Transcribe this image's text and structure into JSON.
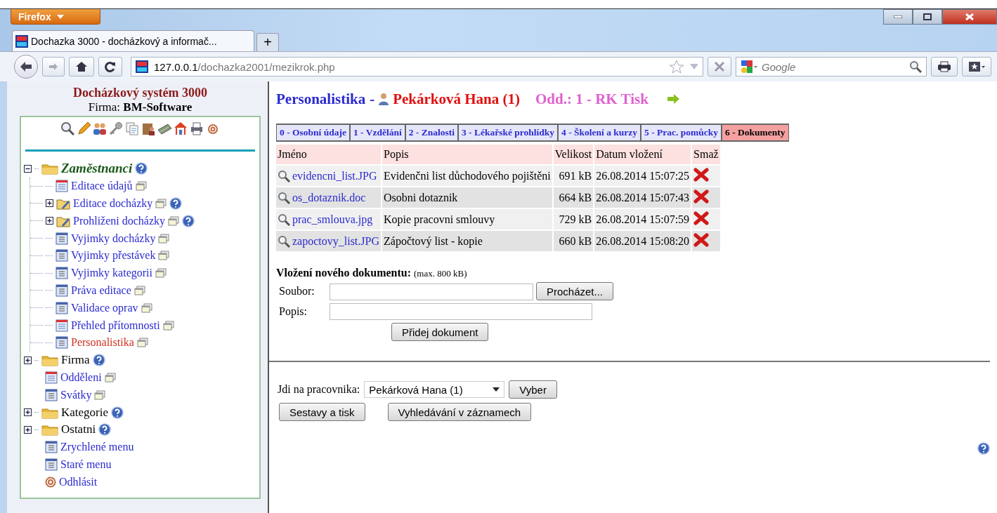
{
  "browser": {
    "menu_button": "Firefox",
    "tab": {
      "title": "Dochazka 3000 - docházkový a informač..."
    },
    "new_tab": "+",
    "url": {
      "host": "127.0.0.1",
      "path": "/dochazka2001/mezikrok.php"
    },
    "search": {
      "placeholder": "Google"
    }
  },
  "sidebar": {
    "title": "Docházkový systém 3000",
    "company": {
      "label": "Firma:",
      "value": "BM-Software"
    },
    "tree": [
      {
        "label": "Zaměstnanci",
        "kind": "folder",
        "expanded": true,
        "selected": false,
        "help": true,
        "popup": false,
        "children": [
          {
            "label": "Editace údajů",
            "kind": "calendar",
            "selected": false,
            "help": false,
            "popup": true
          },
          {
            "label": "Editace docházky",
            "kind": "editfolder",
            "expanded": false,
            "selected": false,
            "help": true,
            "popup": true
          },
          {
            "label": "Prohliženi docházky",
            "kind": "editfolder",
            "expanded": false,
            "selected": false,
            "help": true,
            "popup": true
          },
          {
            "label": "Vyjimky docházky",
            "kind": "page",
            "selected": false,
            "help": false,
            "popup": true
          },
          {
            "label": "Vyjimky přestávek",
            "kind": "page",
            "selected": false,
            "help": false,
            "popup": true
          },
          {
            "label": "Vyjimky kategorii",
            "kind": "page",
            "selected": false,
            "help": false,
            "popup": true
          },
          {
            "label": "Práva editace",
            "kind": "page",
            "selected": false,
            "help": false,
            "popup": true
          },
          {
            "label": "Validace oprav",
            "kind": "page",
            "selected": false,
            "help": false,
            "popup": true
          },
          {
            "label": "Přehled přítomnosti",
            "kind": "calendar",
            "selected": false,
            "help": false,
            "popup": true
          },
          {
            "label": "Personalistika",
            "kind": "page",
            "selected": true,
            "help": false,
            "popup": true
          }
        ]
      },
      {
        "label": "Firma",
        "kind": "folder",
        "expanded": false,
        "selected": false,
        "help": true,
        "popup": false
      },
      {
        "label": "Odděleni",
        "kind": "calendar",
        "selected": false,
        "help": false,
        "popup": true
      },
      {
        "label": "Svátky",
        "kind": "page",
        "selected": false,
        "help": false,
        "popup": true
      },
      {
        "label": "Kategorie",
        "kind": "folder",
        "expanded": false,
        "selected": false,
        "help": true,
        "popup": false
      },
      {
        "label": "Ostatni",
        "kind": "folder",
        "expanded": false,
        "selected": false,
        "help": true,
        "popup": false
      },
      {
        "label": "Zrychlené menu",
        "kind": "page",
        "selected": false,
        "help": false,
        "popup": false
      },
      {
        "label": "Staré menu",
        "kind": "page",
        "selected": false,
        "help": false,
        "popup": false
      },
      {
        "label": "Odhlásit",
        "kind": "logout",
        "selected": false,
        "help": false,
        "popup": false
      }
    ]
  },
  "main": {
    "heading": {
      "section": "Personalistika",
      "separator": "-",
      "employee": "Pekárková Hana (1)",
      "department": "Odd.: 1 - RK Tisk"
    },
    "tabs": [
      {
        "label": "0 - Osobní údaje",
        "selected": false
      },
      {
        "label": "1 - Vzdělání",
        "selected": false
      },
      {
        "label": "2 - Znalosti",
        "selected": false
      },
      {
        "label": "3 - Lékařské prohlídky",
        "selected": false
      },
      {
        "label": "4 - Školení a kurzy",
        "selected": false
      },
      {
        "label": "5 - Prac. pomůcky",
        "selected": false
      },
      {
        "label": "6 - Dokumenty",
        "selected": true
      }
    ],
    "table": {
      "columns": [
        "Jméno",
        "Popis",
        "Velikost",
        "Datum vložení",
        "Smaž"
      ],
      "rows": [
        {
          "name": "evidencni_list.JPG",
          "description": "Evidenčni list důchodového pojištěni",
          "size": "691 kB",
          "date": "26.08.2014 15:07:25"
        },
        {
          "name": "os_dotaznik.doc",
          "description": "Osobni dotaznik",
          "size": "664 kB",
          "date": "26.08.2014 15:07:43"
        },
        {
          "name": "prac_smlouva.jpg",
          "description": "Kopie pracovni smlouvy",
          "size": "729 kB",
          "date": "26.08.2014 15:07:59"
        },
        {
          "name": "zapoctovy_list.JPG",
          "description": "Zápočtový list - kopie",
          "size": "660 kB",
          "date": "26.08.2014 15:08:20"
        }
      ]
    },
    "upload": {
      "title": "Vložení nového dokumentu:",
      "note": "(max. 800 kB)",
      "file_label": "Soubor:",
      "browse": "Procházet...",
      "description_label": "Popis:",
      "submit": "Přidej dokument"
    },
    "jump": {
      "label": "Jdi na pracovnika:",
      "value": "Pekárková Hana (1)",
      "button": "Vyber"
    },
    "buttons": [
      "Sestavy a tisk",
      "Vyhledávání v záznamech"
    ]
  }
}
